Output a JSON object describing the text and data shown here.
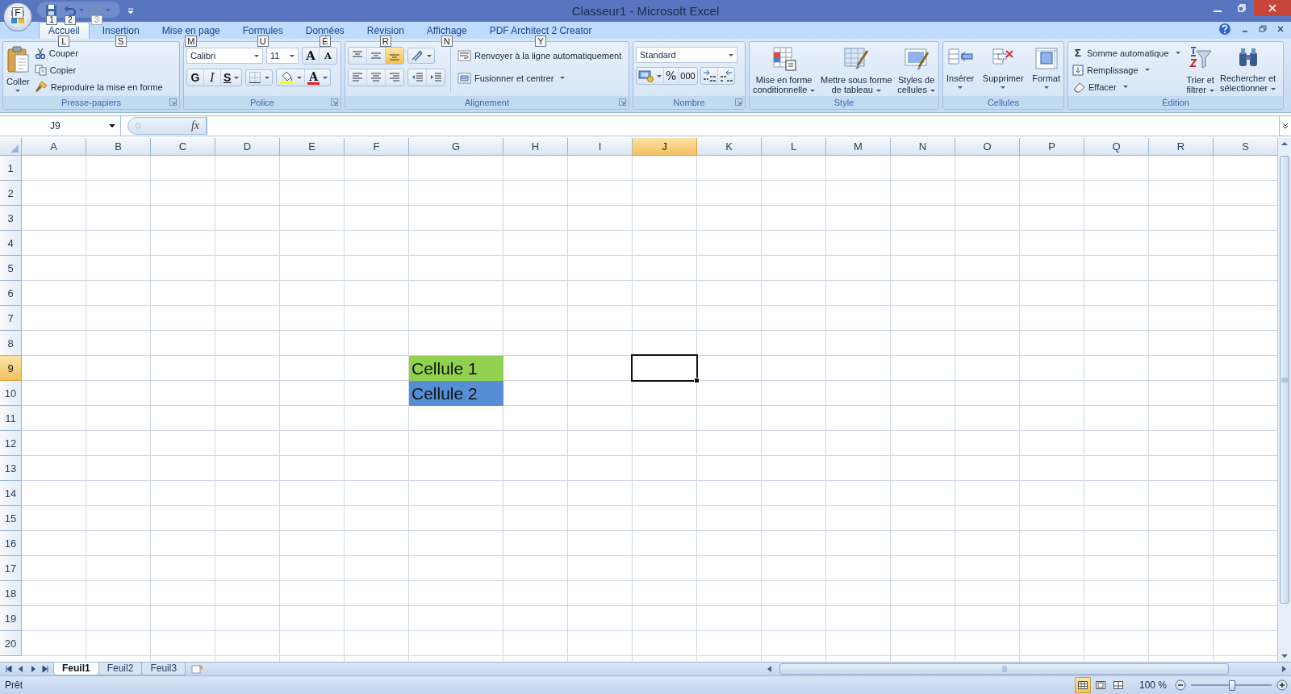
{
  "window": {
    "title": "Classeur1 - Microsoft Excel",
    "office_keytip": "F",
    "quick_access_keytips": [
      "1",
      "2",
      "3"
    ]
  },
  "tabs": [
    {
      "label": "Accueil",
      "keytip": "L",
      "selected": true
    },
    {
      "label": "Insertion",
      "keytip": "S",
      "selected": false
    },
    {
      "label": "Mise en page",
      "keytip": "M",
      "selected": false
    },
    {
      "label": "Formules",
      "keytip": "U",
      "selected": false
    },
    {
      "label": "Données",
      "keytip": "É",
      "selected": false
    },
    {
      "label": "Révision",
      "keytip": "R",
      "selected": false
    },
    {
      "label": "Affichage",
      "keytip": "N",
      "selected": false
    },
    {
      "label": "PDF Architect 2 Creator",
      "keytip": "Y",
      "selected": false
    }
  ],
  "ribbon": {
    "clipboard": {
      "title": "Presse-papiers",
      "paste": "Coller",
      "actions": [
        "Couper",
        "Copier",
        "Reproduire la mise en forme"
      ]
    },
    "font": {
      "title": "Police",
      "font_name": "Calibri",
      "font_size": "11",
      "grow": "A",
      "shrink": "A",
      "bold": "G",
      "italic": "I",
      "underline": "S",
      "font_color": "A"
    },
    "alignment": {
      "title": "Alignement",
      "vertical": [
        {
          "selected": false
        },
        {
          "selected": false
        },
        {
          "selected": true
        }
      ],
      "wrap": "Renvoyer à la ligne automatiquement",
      "merge": "Fusionner et centrer"
    },
    "number": {
      "title": "Nombre",
      "format": "Standard",
      "percent": "%",
      "thousands": "000"
    },
    "styles": {
      "title": "Style",
      "buttons": [
        {
          "lines": [
            "Mise en forme",
            "conditionnelle"
          ]
        },
        {
          "lines": [
            "Mettre sous forme",
            "de tableau"
          ]
        },
        {
          "lines": [
            "Styles de",
            "cellules"
          ]
        }
      ]
    },
    "cells": {
      "title": "Cellules",
      "buttons": [
        {
          "lines": [
            "Insérer"
          ]
        },
        {
          "lines": [
            "Supprimer"
          ]
        },
        {
          "lines": [
            "Format"
          ]
        }
      ]
    },
    "editing": {
      "title": "Édition",
      "autosum_symbol": "Σ",
      "actions": [
        "Somme automatique",
        "Remplissage",
        "Effacer"
      ],
      "buttons": [
        {
          "lines": [
            "Trier et",
            "filtrer"
          ]
        },
        {
          "lines": [
            "Rechercher et",
            "sélectionner"
          ]
        }
      ]
    }
  },
  "formula_bar": {
    "name_box": "J9",
    "function_label": "fx"
  },
  "grid": {
    "columns": [
      {
        "label": "A",
        "selected": false
      },
      {
        "label": "B",
        "selected": false
      },
      {
        "label": "C",
        "selected": false
      },
      {
        "label": "D",
        "selected": false
      },
      {
        "label": "E",
        "selected": false
      },
      {
        "label": "F",
        "selected": false
      },
      {
        "label": "G",
        "selected": false
      },
      {
        "label": "H",
        "selected": false
      },
      {
        "label": "I",
        "selected": false
      },
      {
        "label": "J",
        "selected": true
      },
      {
        "label": "K",
        "selected": false
      },
      {
        "label": "L",
        "selected": false
      },
      {
        "label": "M",
        "selected": false
      },
      {
        "label": "N",
        "selected": false
      },
      {
        "label": "O",
        "selected": false
      },
      {
        "label": "P",
        "selected": false
      },
      {
        "label": "Q",
        "selected": false
      },
      {
        "label": "R",
        "selected": false
      },
      {
        "label": "S",
        "selected": false
      }
    ],
    "rows": [
      {
        "label": "1",
        "selected": false
      },
      {
        "label": "2",
        "selected": false
      },
      {
        "label": "3",
        "selected": false
      },
      {
        "label": "4",
        "selected": false
      },
      {
        "label": "5",
        "selected": false
      },
      {
        "label": "6",
        "selected": false
      },
      {
        "label": "7",
        "selected": false
      },
      {
        "label": "8",
        "selected": false
      },
      {
        "label": "9",
        "selected": true,
        "cells": [
          {
            "kind": "empty"
          },
          {
            "kind": "empty"
          },
          {
            "kind": "empty"
          },
          {
            "kind": "empty"
          },
          {
            "kind": "empty"
          },
          {
            "kind": "empty"
          },
          {
            "kind": "text",
            "text": "Cellule 1",
            "color": "#92d050"
          }
        ]
      },
      {
        "label": "10",
        "selected": false,
        "cells": [
          {
            "kind": "empty"
          },
          {
            "kind": "empty"
          },
          {
            "kind": "empty"
          },
          {
            "kind": "empty"
          },
          {
            "kind": "empty"
          },
          {
            "kind": "empty"
          },
          {
            "kind": "text",
            "text": "Cellule 2",
            "color": "#558ed5"
          }
        ]
      },
      {
        "label": "11",
        "selected": false
      },
      {
        "label": "12",
        "selected": false
      },
      {
        "label": "13",
        "selected": false
      },
      {
        "label": "14",
        "selected": false
      },
      {
        "label": "15",
        "selected": false
      },
      {
        "label": "16",
        "selected": false
      },
      {
        "label": "17",
        "selected": false
      },
      {
        "label": "18",
        "selected": false
      },
      {
        "label": "19",
        "selected": false
      },
      {
        "label": "20",
        "selected": false
      }
    ]
  },
  "sheet_tabs": [
    {
      "label": "Feuil1",
      "selected": true
    },
    {
      "label": "Feuil2",
      "selected": false
    },
    {
      "label": "Feuil3",
      "selected": false
    }
  ],
  "status_bar": {
    "text": "Prêt",
    "zoom": "100 %",
    "zoom_slider": {
      "level": 0.5
    }
  }
}
